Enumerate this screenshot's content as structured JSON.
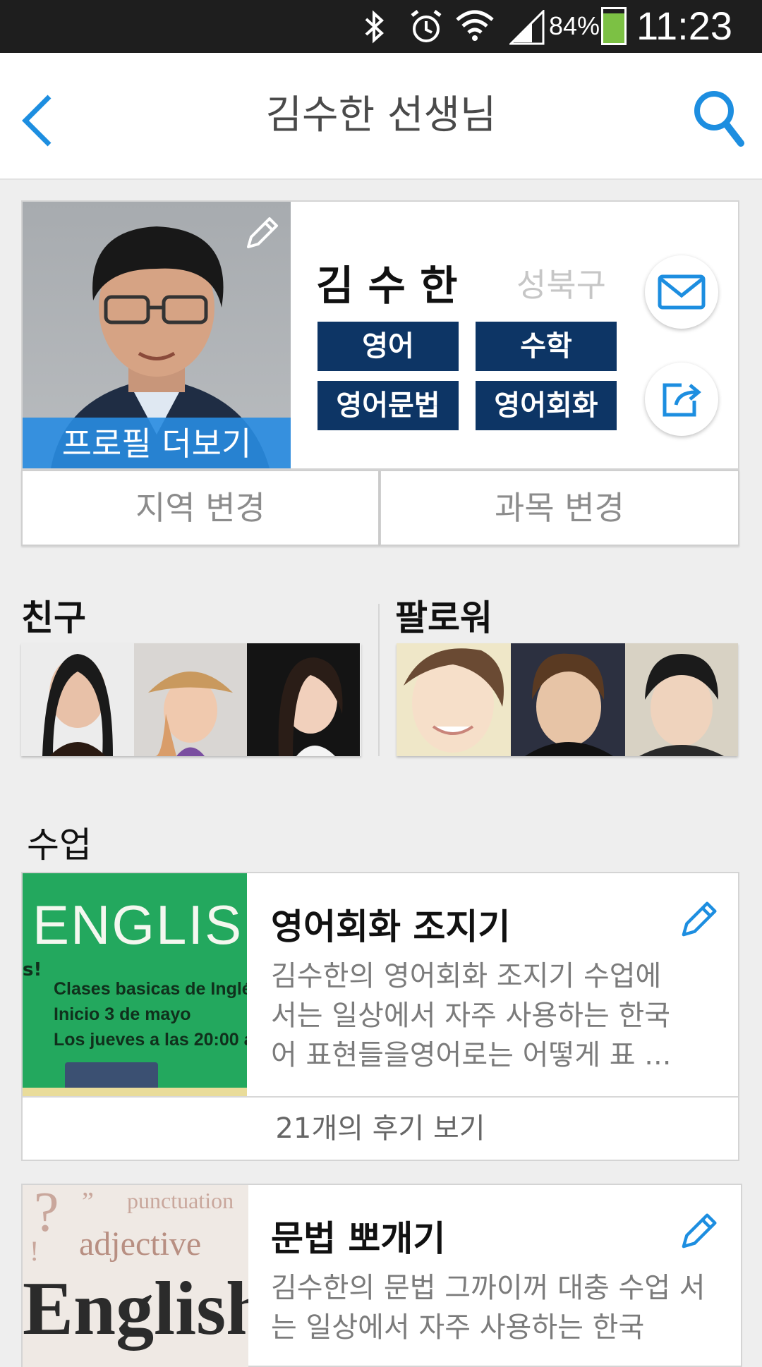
{
  "status_bar": {
    "battery": "84%",
    "time": "11:23",
    "battery_color": "#7cc144"
  },
  "nav": {
    "title": "김수한 선생님",
    "accent": "#1d8ee0"
  },
  "profile": {
    "name": "김 수 한",
    "region": "성북구",
    "tags": [
      "영어",
      "수학",
      "영어문법",
      "영어회화"
    ],
    "more_label": "프로필 더보기",
    "change_region": "지역 변경",
    "change_subject": "과목 변경"
  },
  "friends": {
    "title": "친구"
  },
  "followers": {
    "title": "팔로워"
  },
  "lessons": {
    "title": "수업",
    "items": [
      {
        "title": "영어회화 조지기",
        "desc": "김수한의 영어회화 조지기 수업에 서는 일상에서 자주 사용하는 한국 어 표현들을영어로는 어떻게 표 ...",
        "image_text": {
          "headline": "ENGLISH",
          "line1": "Clases basicas de Inglé",
          "line2": "Inicio 3 de mayo",
          "line3": "Los jueves a las 20:00 a",
          "side": "s!"
        },
        "review_label": "21개의 후기 보기"
      },
      {
        "title": "문법 뽀개기",
        "desc": "김수한의 문법 그까이꺼 대충 수업 서는 일상에서 자주 사용하는 한국",
        "image_text": {
          "w1": "punctuation",
          "w2": "adjective",
          "w3": "English"
        }
      }
    ]
  }
}
